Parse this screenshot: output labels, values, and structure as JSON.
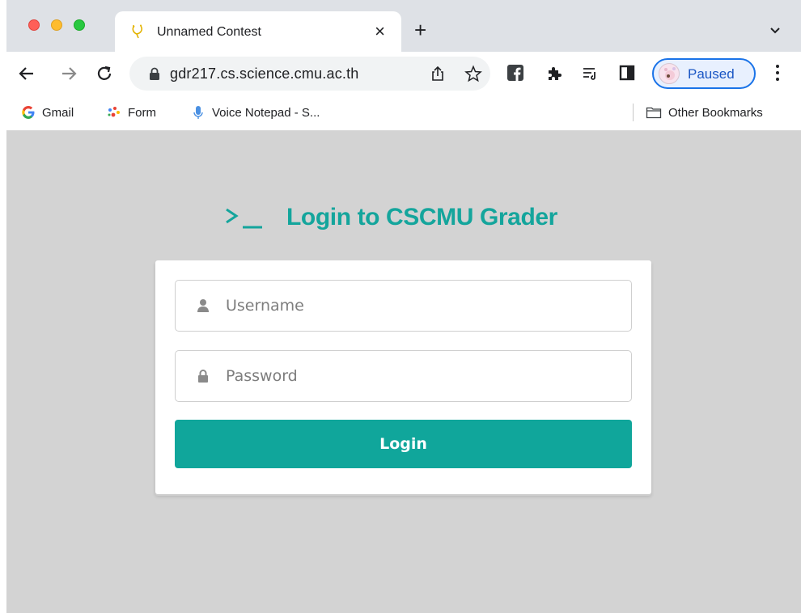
{
  "browser": {
    "tab": {
      "title": "Unnamed Contest"
    },
    "address": {
      "url": "gdr217.cs.science.cmu.ac.th"
    },
    "profile": {
      "label": "Paused"
    },
    "bookmarks": [
      {
        "label": "Gmail"
      },
      {
        "label": "Form"
      },
      {
        "label": "Voice Notepad - S..."
      }
    ],
    "other_bookmarks": {
      "label": "Other Bookmarks"
    }
  },
  "page": {
    "heading": {
      "icon": ">_",
      "title": "Login to CSCMU Grader"
    },
    "form": {
      "username": {
        "placeholder": "Username",
        "value": ""
      },
      "password": {
        "placeholder": "Password",
        "value": ""
      },
      "login_label": "Login"
    }
  },
  "colors": {
    "accent": "#10a69b",
    "page_background": "#d3d3d3"
  }
}
